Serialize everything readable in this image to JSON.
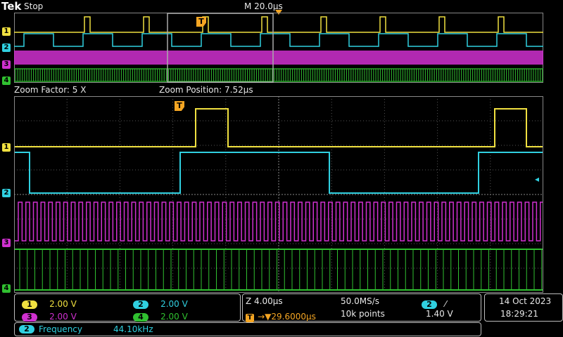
{
  "header": {
    "logo": "Tek",
    "state": "Stop",
    "timebase": "M 20.0µs"
  },
  "overview_markers": {
    "trigger": "T"
  },
  "zoom_info": {
    "factor": "Zoom Factor: 5 X",
    "position": "Zoom Position: 7.52µs"
  },
  "channels": [
    {
      "num": "1",
      "volts": "2.00 V",
      "color": "#f0e040"
    },
    {
      "num": "2",
      "volts": "2.00 V",
      "color": "#30d0e0"
    },
    {
      "num": "3",
      "volts": "2.00 V",
      "color": "#d030d0"
    },
    {
      "num": "4",
      "volts": "2.00 V",
      "color": "#30c030"
    }
  ],
  "acquisition": {
    "zoom_scale": "Z 4.00µs",
    "sample_rate": "50.0MS/s",
    "trigger_pos_icon": "T",
    "trigger_delay": "→▼29.6000µs",
    "record_length": "10k points",
    "trigger_channel": "2",
    "trigger_slope": "⁄",
    "trigger_level": "1.40 V"
  },
  "datetime": {
    "date": "14 Oct  2023",
    "time": "18:29:21"
  },
  "measurement": {
    "channel": "2",
    "name": "Frequency",
    "value": "44.10kHz"
  },
  "colors": {
    "ch1": "#f0e040",
    "ch2": "#30d0e0",
    "ch3": "#d030d0",
    "ch4": "#30c030",
    "trigger": "#f5a623",
    "grid": "#555555"
  }
}
